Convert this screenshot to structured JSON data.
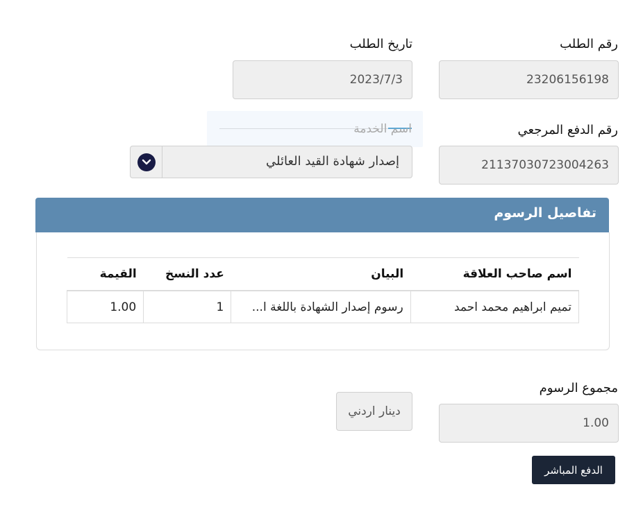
{
  "request": {
    "number_label": "رقم الطلب",
    "number_value": "23206156198",
    "date_label": "تاريخ الطلب",
    "date_value": "2023/7/3"
  },
  "payment": {
    "reference_label": "رقم الدفع المرجعي",
    "reference_value": "2113703072300426​3"
  },
  "service": {
    "label": "اسم الخدمة",
    "selected": "إصدار شهادة القيد العائلي",
    "dropdown_icon": "chevron-down-icon"
  },
  "fees_panel": {
    "title": "تفاصيل الرسوم",
    "headers": {
      "relative": "اسم صاحب العلاقة",
      "statement": "البيان",
      "copies": "عدد النسخ",
      "value": "القيمة"
    },
    "rows": [
      {
        "relative": "تميم ابراهيم محمد احمد",
        "statement": "رسوم إصدار الشهادة باللغة ا...",
        "copies": "1",
        "value": "1.00"
      }
    ]
  },
  "total": {
    "label": "مجموع الرسوم",
    "value": "1.00",
    "currency": "دينار اردني"
  },
  "actions": {
    "pay_label": "الدفع المباشر"
  },
  "colors": {
    "panel_header": "#5d8ab0",
    "button_dark": "#1b2536",
    "dropdown_circle": "#181b45"
  }
}
